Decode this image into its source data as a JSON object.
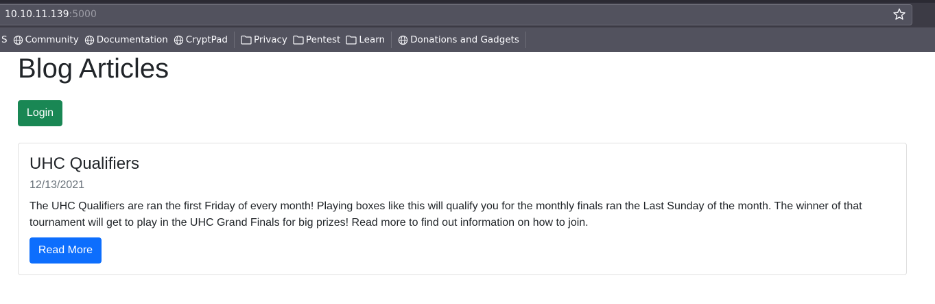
{
  "browser": {
    "url_host": "10.10.11.139",
    "url_port": ":5000",
    "bookmarks": {
      "partial": "S",
      "items": [
        {
          "label": "Community",
          "icon": "globe-icon"
        },
        {
          "label": "Documentation",
          "icon": "globe-icon"
        },
        {
          "label": "CryptPad",
          "icon": "globe-icon"
        },
        {
          "label": "Privacy",
          "icon": "folder-icon"
        },
        {
          "label": "Pentest",
          "icon": "folder-icon"
        },
        {
          "label": "Learn",
          "icon": "folder-icon"
        },
        {
          "label": "Donations and Gadgets",
          "icon": "globe-icon"
        }
      ]
    }
  },
  "page": {
    "title": "Blog Articles",
    "login_label": "Login",
    "article": {
      "title": "UHC Qualifiers",
      "date": "12/13/2021",
      "body": "The UHC Qualifiers are ran the first Friday of every month! Playing boxes like this will qualify you for the monthly finals ran the Last Sunday of the month. The winner of that tournament will get to play in the UHC Grand Finals for big prizes! Read more to find out information on how to join.",
      "read_more_label": "Read More"
    }
  },
  "colors": {
    "login_button": "#198754",
    "read_more_button": "#0d6efd",
    "chrome_bg": "#3c3b45",
    "toolbar_bg": "#52525e"
  }
}
